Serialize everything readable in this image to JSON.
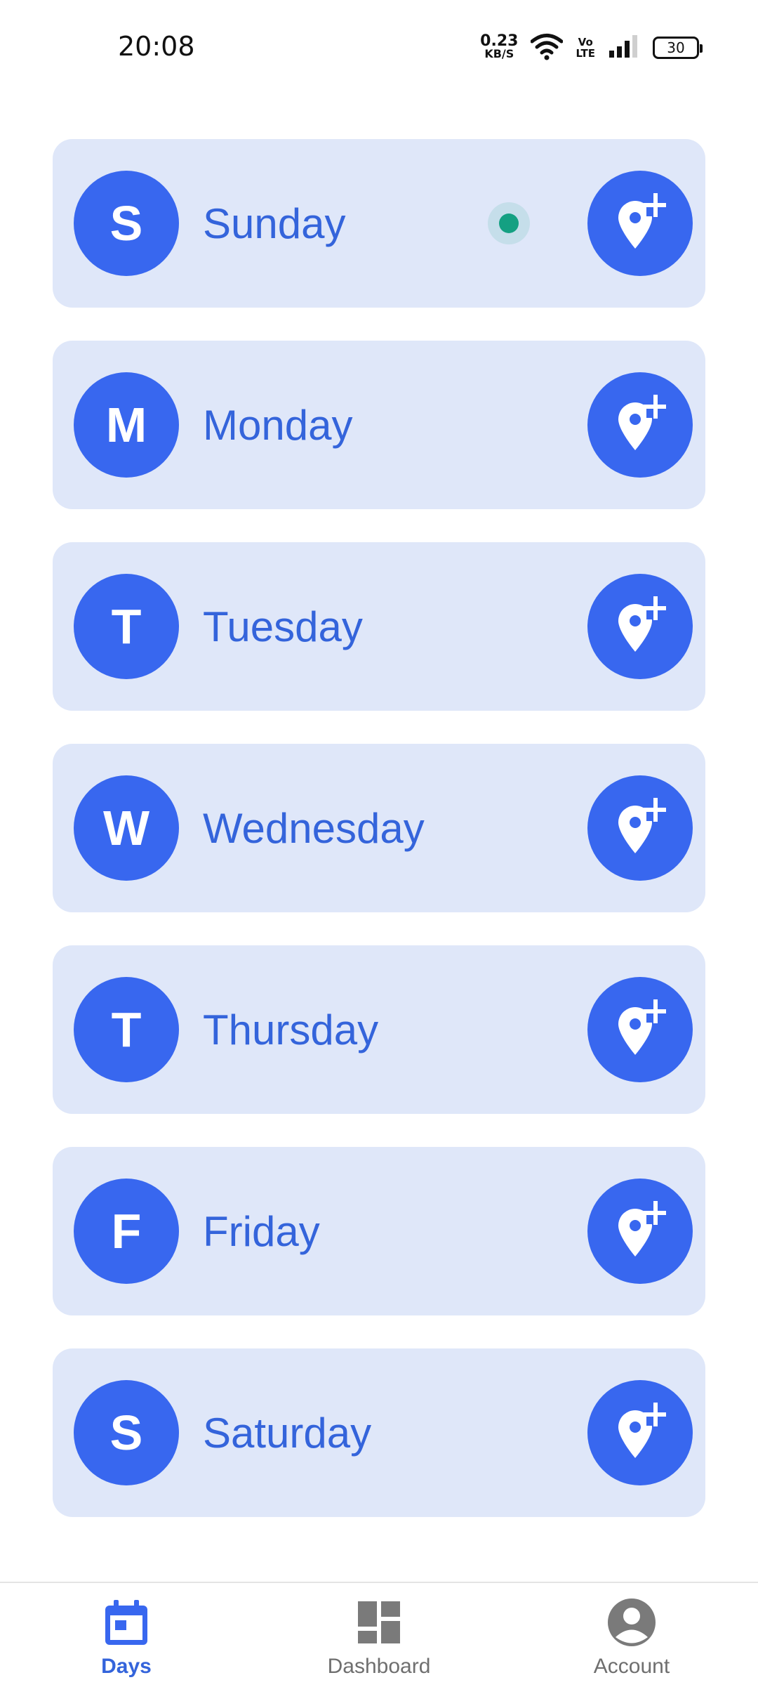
{
  "status_bar": {
    "time": "20:08",
    "net_speed_value": "0.23",
    "net_speed_unit": "KB/S",
    "volte_top": "Vo",
    "volte_bottom": "LTE",
    "battery": "30",
    "icons": [
      "wifi-icon",
      "signal-icon",
      "battery-icon"
    ]
  },
  "days": [
    {
      "letter": "S",
      "name": "Sunday",
      "has_dot": true
    },
    {
      "letter": "M",
      "name": "Monday",
      "has_dot": false
    },
    {
      "letter": "T",
      "name": "Tuesday",
      "has_dot": false
    },
    {
      "letter": "W",
      "name": "Wednesday",
      "has_dot": false
    },
    {
      "letter": "T",
      "name": "Thursday",
      "has_dot": false
    },
    {
      "letter": "F",
      "name": "Friday",
      "has_dot": false
    },
    {
      "letter": "S",
      "name": "Saturday",
      "has_dot": false
    }
  ],
  "day_action_icon": "add-location-icon",
  "bottom_nav": {
    "items": [
      {
        "label": "Days",
        "icon": "calendar-icon",
        "active": true
      },
      {
        "label": "Dashboard",
        "icon": "dashboard-icon",
        "active": false
      },
      {
        "label": "Account",
        "icon": "account-circle-icon",
        "active": false
      }
    ]
  },
  "colors": {
    "accent": "#3867ef",
    "card_bg": "#dfe7f9",
    "day_text": "#3464db",
    "dot": "#14a082",
    "nav_inactive": "#6f6f6f"
  }
}
